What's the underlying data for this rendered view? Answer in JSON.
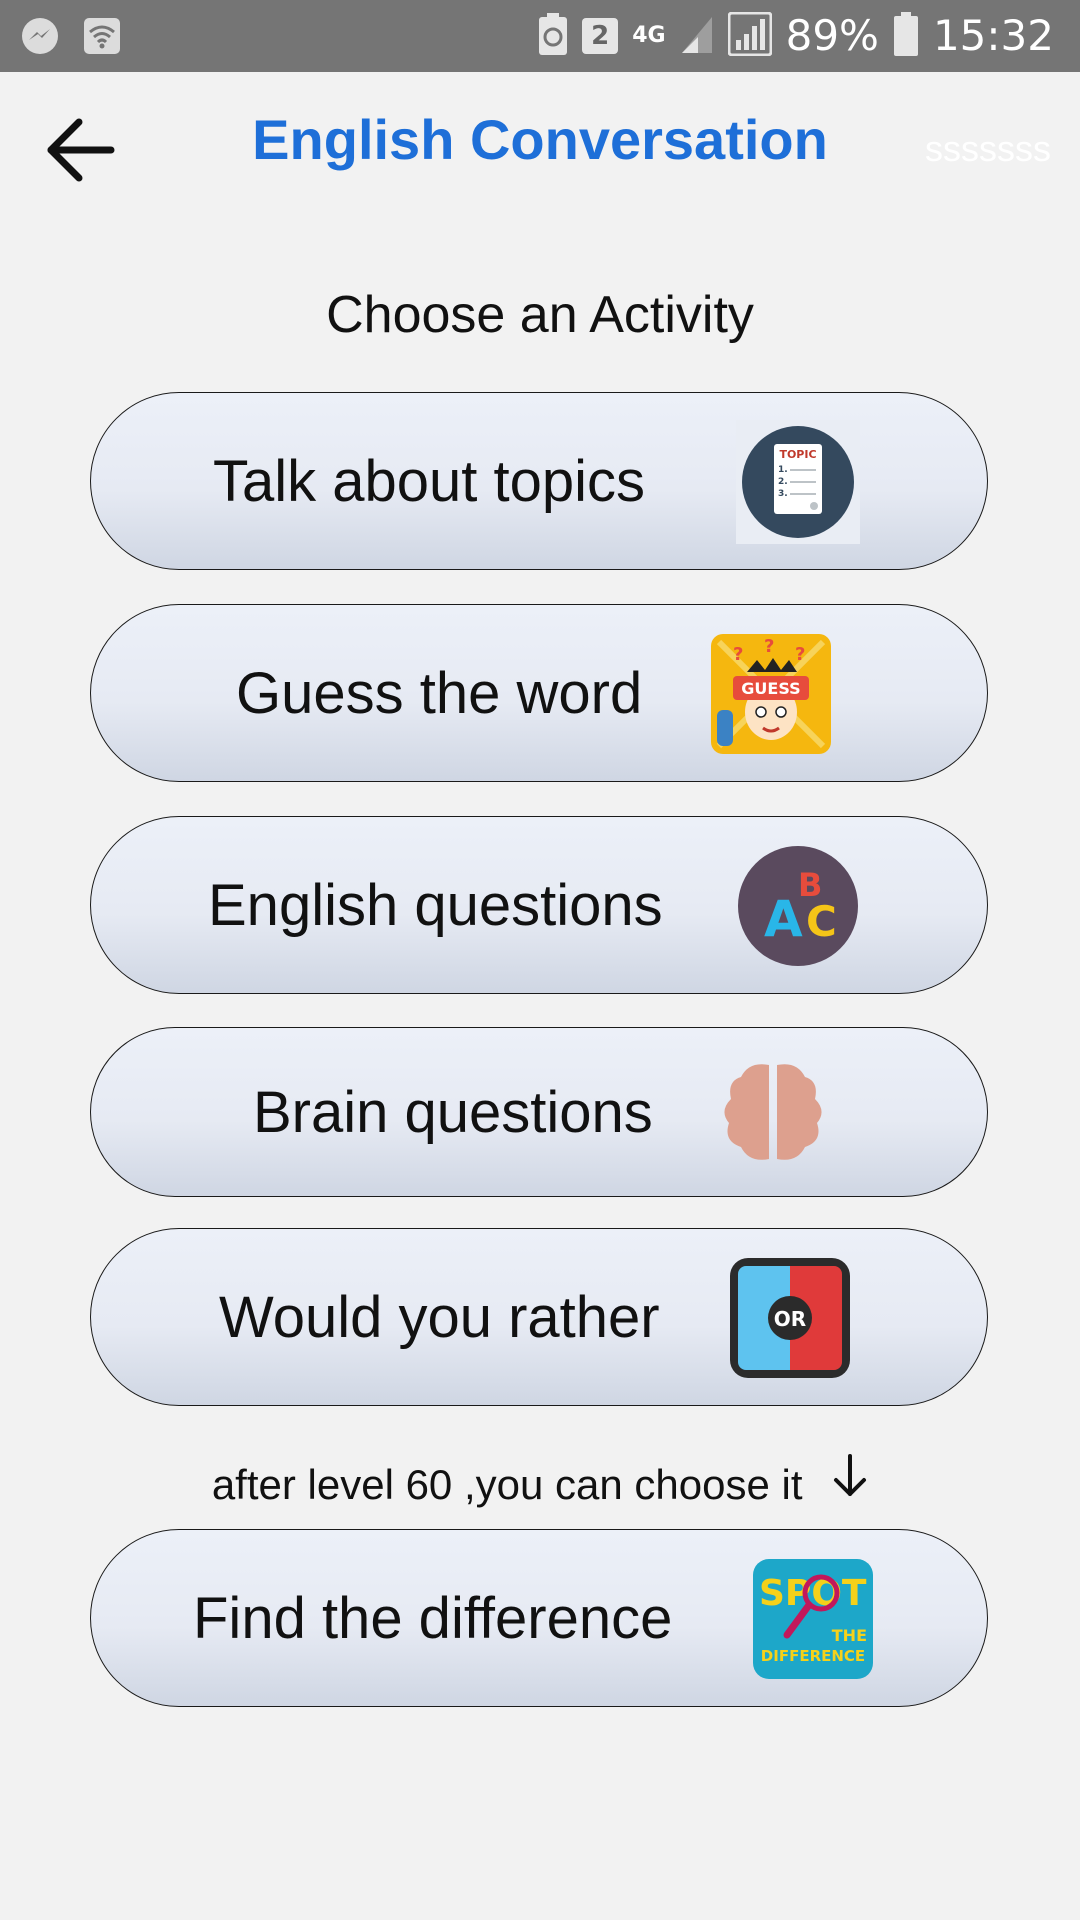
{
  "status_bar": {
    "network": "4G",
    "sim_badge": "2",
    "battery": "89%",
    "time": "15:32"
  },
  "header": {
    "title": "English Conversation",
    "menu_hint": "sssssss"
  },
  "subtitle": "Choose an Activity",
  "activities": [
    {
      "label": "Talk about topics",
      "icon": "topic-icon",
      "icon_text": "TOPIC"
    },
    {
      "label": "Guess the word",
      "icon": "guess-icon",
      "icon_text": "GUESS"
    },
    {
      "label": "English questions",
      "icon": "abc-icon",
      "icon_text": "ABC"
    },
    {
      "label": "Brain questions",
      "icon": "brain-icon"
    },
    {
      "label": "Would you rather",
      "icon": "or-icon",
      "icon_text": "OR"
    }
  ],
  "level_note": "after level 60 ,you can choose it",
  "locked_activity": {
    "label": "Find the difference",
    "icon": "spot-the-difference-icon",
    "icon_text_1": "SPOT",
    "icon_text_2": "THE",
    "icon_text_3": "DIFFERENCE"
  },
  "colors": {
    "title": "#1e6fd8",
    "status_bar": "#757575",
    "background": "#f2f2f2"
  }
}
